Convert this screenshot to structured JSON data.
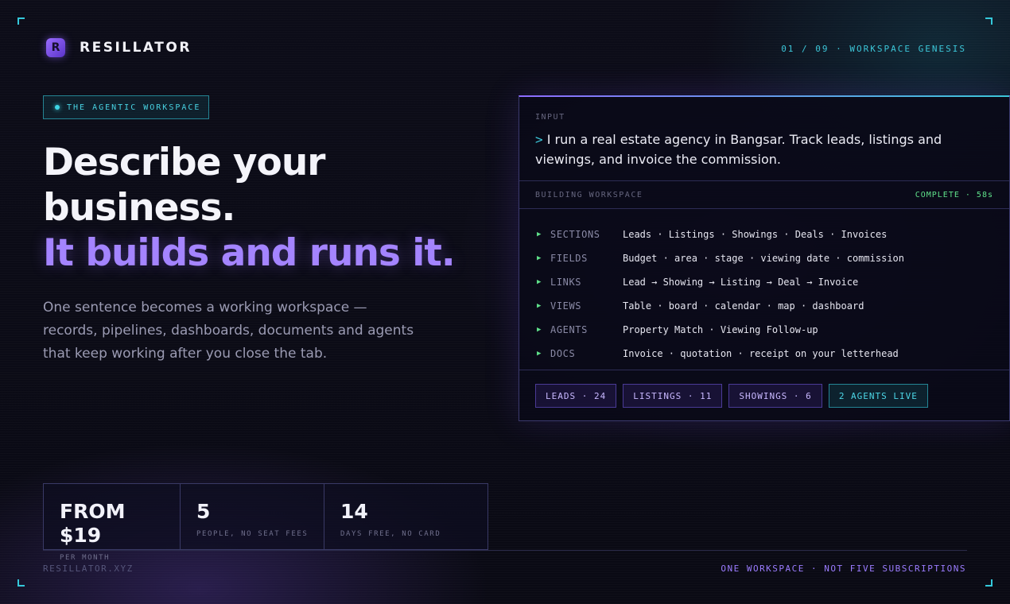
{
  "brand": {
    "logo_letter": "R",
    "name": "RESILLATOR"
  },
  "nav": {
    "step_indicator": "01 / 09 · WORKSPACE GENESIS"
  },
  "hero": {
    "tag": "THE AGENTIC WORKSPACE",
    "headline_1": "Describe your",
    "headline_2": "business.",
    "headline_3": "It builds and runs it.",
    "sub_1": "One sentence becomes a working workspace —",
    "sub_2": "records, pipelines, dashboards, documents and agents",
    "sub_3": "that keep working after you close the tab."
  },
  "stats": [
    {
      "value": "FROM $19",
      "label": "PER MONTH"
    },
    {
      "value": "5",
      "label": "PEOPLE, NO SEAT FEES"
    },
    {
      "value": "14",
      "label": "DAYS FREE, NO CARD"
    }
  ],
  "footer": {
    "left": "RESILLATOR.XYZ",
    "right": "ONE WORKSPACE · NOT FIVE SUBSCRIPTIONS"
  },
  "panel": {
    "input_label": "INPUT",
    "prompt_symbol": ">",
    "input_text": "I run a real estate agency in Bangsar. Track leads, listings and viewings, and invoice the commission.",
    "build_label": "BUILDING WORKSPACE",
    "build_status": "COMPLETE · 58s",
    "rows": [
      {
        "key": "SECTIONS",
        "value": "Leads · Listings · Showings · Deals · Invoices"
      },
      {
        "key": "FIELDS",
        "value": "Budget · area · stage · viewing date · commission"
      },
      {
        "key": "LINKS",
        "value": "Lead → Showing → Listing → Deal → Invoice"
      },
      {
        "key": "VIEWS",
        "value": "Table · board · calendar · map · dashboard"
      },
      {
        "key": "AGENTS",
        "value": "Property Match · Viewing Follow-up"
      },
      {
        "key": "DOCS",
        "value": "Invoice · quotation · receipt on your letterhead"
      }
    ],
    "chips": [
      "LEADS · 24",
      "LISTINGS · 11",
      "SHOWINGS · 6",
      "2 AGENTS LIVE"
    ]
  },
  "icons": {
    "logo": "logo-r-icon",
    "row_marker": "triangle-right-icon",
    "status_dot": "dot-icon"
  },
  "colors": {
    "accent_purple": "#a484ff",
    "accent_cyan": "#3cc6d8",
    "success_green": "#5fe08a",
    "background": "#0b0b16"
  }
}
